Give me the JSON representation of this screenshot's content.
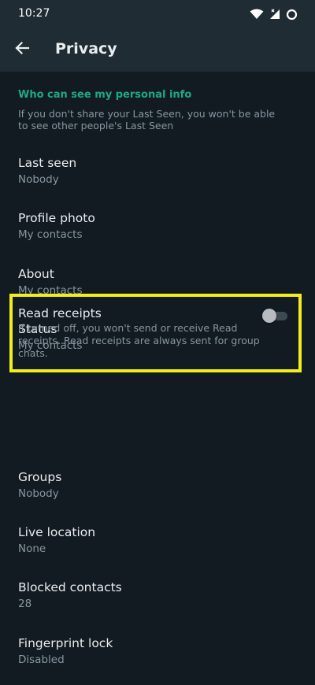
{
  "status_bar": {
    "time": "10:27",
    "icons": [
      "wifi-icon",
      "signal-icon",
      "battery-icon"
    ]
  },
  "app_bar": {
    "back_icon": "arrow-left-icon",
    "title": "Privacy"
  },
  "section": {
    "header": "Who can see my personal info",
    "description": "If you don't share your Last Seen, you won't be able to see other people's Last Seen"
  },
  "items": [
    {
      "title": "Last seen",
      "value": "Nobody"
    },
    {
      "title": "Profile photo",
      "value": "My contacts"
    },
    {
      "title": "About",
      "value": "My contacts"
    },
    {
      "title": "Status",
      "value": "My contacts"
    }
  ],
  "read_receipts": {
    "title": "Read receipts",
    "description": "If turned off, you won't send or receive Read receipts. Read receipts are always sent for group chats.",
    "enabled": false
  },
  "items_after": [
    {
      "title": "Groups",
      "value": "Nobody"
    },
    {
      "title": "Live location",
      "value": "None"
    },
    {
      "title": "Blocked contacts",
      "value": "28"
    },
    {
      "title": "Fingerprint lock",
      "value": "Disabled"
    }
  ],
  "colors": {
    "background": "#121b22",
    "bar": "#1f2c34",
    "accent": "#1fa785",
    "highlight": "#f2ed1c"
  }
}
